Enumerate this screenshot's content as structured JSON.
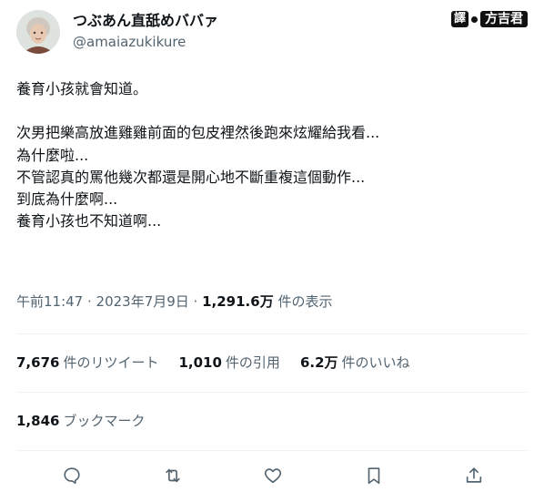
{
  "author": {
    "display_name": "つぶあん直舐めババァ",
    "handle": "@amaiazukikure"
  },
  "stamp": {
    "label": "譯",
    "name": "方吉君"
  },
  "tweet": {
    "lines": [
      "養育小孩就會知道。",
      "",
      "次男把樂高放進雞雞前面的包皮裡然後跑來炫耀給我看...",
      "為什麼啦...",
      "不管認真的罵他幾次都還是開心地不斷重複這個動作...",
      "到底為什麼啊...",
      "養育小孩也不知道啊..."
    ]
  },
  "meta": {
    "time": "午前11:47 · 2023年7月9日 · ",
    "views_count": "1,291.6万",
    "views_label": " 件の表示"
  },
  "stats": {
    "retweets": {
      "count": "7,676",
      "label": "件のリツイート"
    },
    "quotes": {
      "count": "1,010",
      "label": "件の引用"
    },
    "likes": {
      "count": "6.2万",
      "label": "件のいいね"
    }
  },
  "bookmarks": {
    "count": "1,846",
    "label": "ブックマーク"
  },
  "actions": [
    "reply-icon",
    "retweet-icon",
    "like-icon",
    "bookmark-icon",
    "share-icon"
  ],
  "colors": {
    "text": "#0f1419",
    "secondary": "#536471",
    "divider": "#eff3f4"
  }
}
